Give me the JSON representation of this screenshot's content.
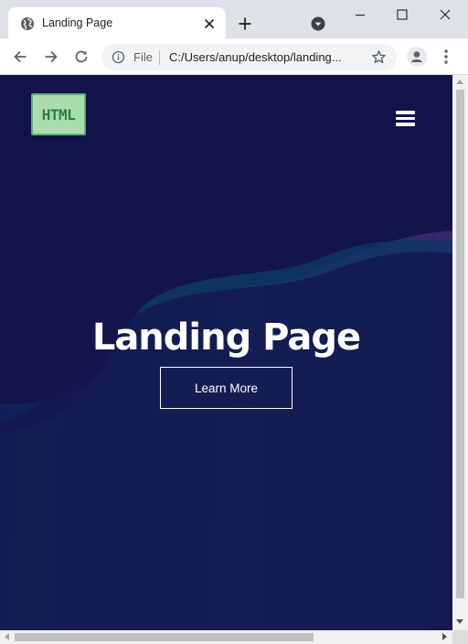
{
  "browser": {
    "tab": {
      "title": "Landing Page",
      "favicon": "globe-icon",
      "close_icon": "close-icon"
    },
    "new_tab_icon": "plus-icon",
    "tab_search_icon": "chevron-down-circle-icon",
    "window_controls": [
      "minimize-icon",
      "maximize-icon",
      "close-icon"
    ],
    "toolbar": {
      "back_icon": "arrow-left-icon",
      "forward_icon": "arrow-right-icon",
      "reload_icon": "reload-icon",
      "omnibox": {
        "info_icon": "info-icon",
        "scheme_label": "File",
        "url": "C:/Users/anup/desktop/landing..."
      },
      "bookmark_icon": "star-icon",
      "profile_icon": "person-icon",
      "menu_icon": "kebab-menu-icon"
    }
  },
  "page": {
    "logo": {
      "text": "HTML",
      "bg_color": "#a9ddb0",
      "text_color": "#2e7d3f"
    },
    "nav_icon": "hamburger-menu-icon",
    "hero": {
      "title": "Landing Page",
      "cta_label": "Learn More",
      "background_color": "#121348",
      "wave_colors": [
        "#0e3a6b",
        "#0d3f63",
        "#3a2a6e"
      ]
    }
  }
}
